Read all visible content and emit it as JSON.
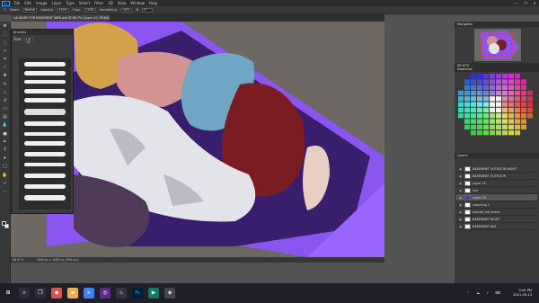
{
  "app": {
    "logo": "Ps",
    "menus": [
      "File",
      "Edit",
      "Image",
      "Layer",
      "Type",
      "Select",
      "Filter",
      "3D",
      "View",
      "Window",
      "Help"
    ],
    "window_controls": [
      "—",
      "❐",
      "✕"
    ]
  },
  "options": {
    "mode_label": "Mode:",
    "mode_value": "Normal",
    "opacity_label": "Opacity:",
    "opacity_value": "100%",
    "flow_label": "Flow:",
    "flow_value": "100%",
    "smoothing_label": "Smoothing:",
    "smoothing_value": "10%",
    "angle_value": "0°"
  },
  "document": {
    "tab_title": "LAUNDRY FOR BASEMENT WEB.psd @ 66.7% (Layer 10, RGB/8) *"
  },
  "brush_panel": {
    "title": "Brushes",
    "size_label": "Size:",
    "size_value": "135 px"
  },
  "right": {
    "navigator_title": "Navigator",
    "swatches_title": "Swatches",
    "layers_title": "Layers",
    "zoom_value": "66.67%"
  },
  "layers": [
    {
      "name": "BASEMENT OUTDOOR NIGHT",
      "selected": false
    },
    {
      "name": "BASEMENT OUTDOOR",
      "selected": false
    },
    {
      "name": "Layer 12",
      "selected": false
    },
    {
      "name": "line",
      "selected": false
    },
    {
      "name": "Layer 10",
      "selected": true
    },
    {
      "name": "colouring 1",
      "selected": false
    },
    {
      "name": "laundry out scene",
      "selected": false
    },
    {
      "name": "BASEMENT NIGHT",
      "selected": false
    },
    {
      "name": "BASEMENT DAY",
      "selected": false
    }
  ],
  "status": {
    "zoom": "66.67%",
    "doc": "3000 px x 1688 px (300 ppi)"
  },
  "taskbar": {
    "time": "3:41 PM",
    "date": "2021-09-13"
  },
  "colors": {
    "accent": "#8a4dff",
    "ui_dark": "#2b2b2b",
    "panel": "#3a3a3a"
  }
}
